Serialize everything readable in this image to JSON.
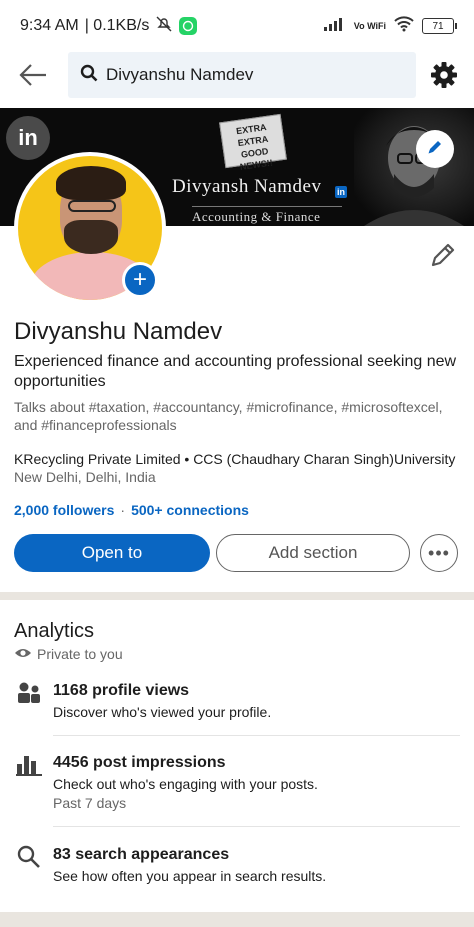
{
  "status_bar": {
    "time": "9:34 AM",
    "net": "| 0.1KB/s",
    "vowifi": "Vo WiFi",
    "battery": "71"
  },
  "search": {
    "query": "Divyanshu Namdev"
  },
  "banner": {
    "name": "Divyansh Namdev",
    "subtitle": "Accounting & Finance",
    "newspaper": "EXTRA EXTRA GOOD NEWS!!"
  },
  "profile": {
    "name": "Divyanshu Namdev",
    "headline": "Experienced finance and accounting professional seeking new opportunities",
    "talks_about": "Talks about #taxation, #accountancy, #microfinance, #microsoftexcel, and #financeprofessionals",
    "company": "KRecycling Private Limited • CCS (Chaudhary Charan Singh)University",
    "location": "New Delhi, Delhi, India",
    "followers": "2,000 followers",
    "connections": "500+ connections",
    "separator": "·"
  },
  "actions": {
    "open_to": "Open to",
    "add_section": "Add section",
    "more": "•••"
  },
  "analytics": {
    "title": "Analytics",
    "private": "Private to you",
    "items": [
      {
        "head": "1168 profile views",
        "desc": "Discover who's viewed your profile.",
        "extra": ""
      },
      {
        "head": "4456 post impressions",
        "desc": "Check out who's engaging with your posts.",
        "extra": "Past 7 days"
      },
      {
        "head": "83 search appearances",
        "desc": "See how often you appear in search results.",
        "extra": ""
      }
    ]
  },
  "colors": {
    "brand_blue": "#0a66c2",
    "avatar_bg": "#f5c518",
    "divider": "#e9e5df"
  }
}
